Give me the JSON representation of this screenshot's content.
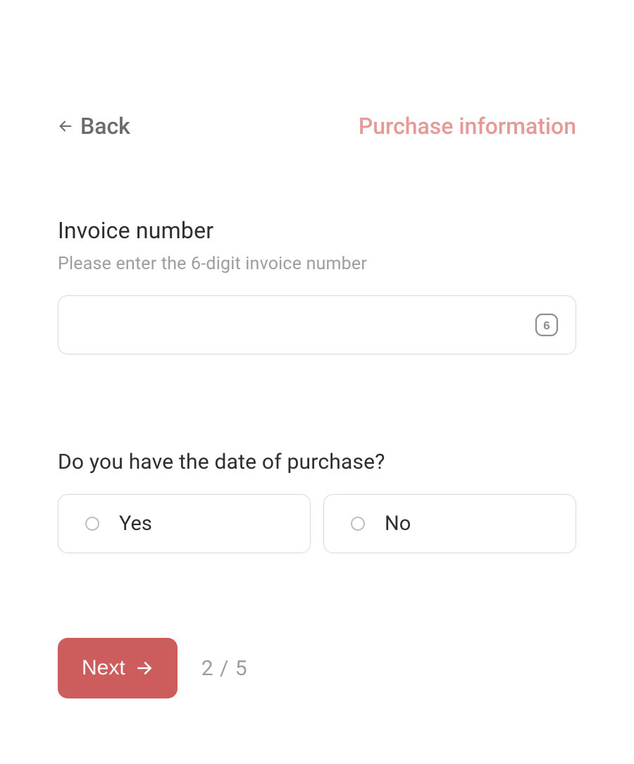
{
  "header": {
    "back_label": "Back",
    "step_title": "Purchase information"
  },
  "invoice": {
    "label": "Invoice number",
    "hint": "Please enter the 6-digit invoice number",
    "value": "",
    "suffix_digit": "6"
  },
  "date_question": {
    "label": "Do you have the date of purchase?",
    "options": {
      "yes": "Yes",
      "no": "No"
    }
  },
  "footer": {
    "next_label": "Next",
    "step_indicator": "2 / 5"
  }
}
